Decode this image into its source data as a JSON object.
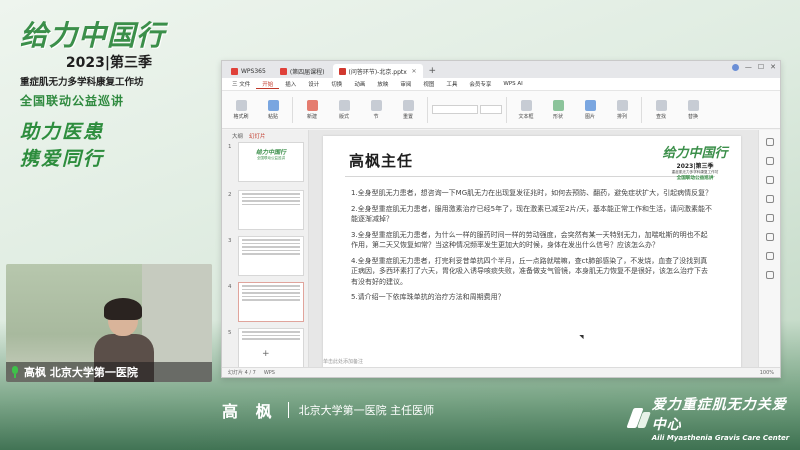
{
  "brand": {
    "logo_title": "给力中国行",
    "season": "2023|第三季",
    "subtitle": "重症肌无力多学科康复工作坊",
    "campaign": "全国联动公益巡讲",
    "slogan_line1": "助力医患",
    "slogan_line2": "携爱同行"
  },
  "video": {
    "nameplate": "高枫 北京大学第一医院"
  },
  "window": {
    "tabs": [
      {
        "label": "WPS365",
        "color": "#e0413a"
      },
      {
        "label": "(第四届课程)",
        "color": "#e0413a"
      },
      {
        "label": "(问答环节)-北京.pptx",
        "color": "#d1382f"
      }
    ],
    "menu": [
      "三 文件",
      "开始",
      "插入",
      "设计",
      "切换",
      "动画",
      "放映",
      "审阅",
      "视图",
      "工具",
      "会员专享",
      "WPS AI"
    ],
    "ribbon": [
      "格式刷",
      "粘贴",
      "新建",
      "版式",
      "节",
      "重置",
      "文本框",
      "形状",
      "图片",
      "排列",
      "查找",
      "替换"
    ],
    "thumbs_header": [
      "大纲",
      "幻灯片"
    ],
    "status": {
      "page": "幻灯片 4 / 7",
      "theme": "WPS",
      "notes_hint": "单击此处添加备注",
      "zoom": "100%"
    }
  },
  "slide": {
    "title": "高枫主任",
    "logo": {
      "title": "给力中国行",
      "season": "2023|第三季",
      "subtitle": "重症肌无力多学科康复工作坊",
      "campaign": "全国联动公益巡讲"
    },
    "questions": [
      "1.全身型肌无力患者，想咨询一下MG肌无力在出现复发征兆时，如何去预防、翻药，避免症状扩大，引起病情反复？",
      "2.全身型重症肌无力患者，服用激素治疗已经5年了，现在激素已减至2片/天，基本能正常工作和生活，请问激素能不能逐渐减掉？",
      "3.全身型重症肌无力患者，为什么一样的服药时间一样的劳动强度，会突然有某一天特别无力，加喘吡斯的明也不起作用，第二天又恢复如常？当这种情况频率发生更加大的时候，身体在发出什么信号？应该怎么办？",
      "4.全身型重症肌无力患者，打完利妥昔单抗四个半月，丘一点路就喘嘛，查ct肺部感染了，不发烧，血查了没找到真正病因，多西环素打了六天，胃化吸入诱导咳痰失败，准备做支气管镜，本身肌无力恢复不是很好，该怎么治疗下去有没有好的建议。",
      "5.请介绍一下依库珠单抗的治疗方法和周期费用？"
    ]
  },
  "lower_third": {
    "name": "高 枫",
    "affiliation": "北京大学第一医院 主任医师"
  },
  "org": {
    "name_cn": "爱力重症肌无力关爱中心",
    "name_en": "Aili Myasthenia Gravis Care Center"
  }
}
